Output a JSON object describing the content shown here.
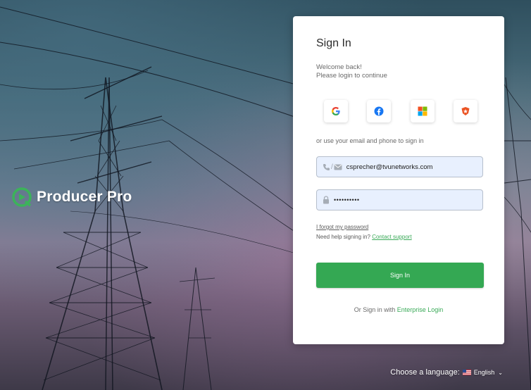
{
  "brand": {
    "name": "Producer Pro"
  },
  "card": {
    "title": "Sign In",
    "welcome_line1": "Welcome back!",
    "welcome_line2": "Please login to continue",
    "social_icons": [
      "google-icon",
      "facebook-icon",
      "microsoft-icon",
      "auth0-icon"
    ],
    "or_text": "or use your email and phone to sign in",
    "email_value": "csprecher@tvunetworks.com",
    "password_value": "••••••••••",
    "forgot_label": "I forgot my password",
    "help_prefix": "Need help signing in?",
    "help_link": "Contact support",
    "signin_label": "Sign In",
    "enterprise_prefix": "Or Sign in with",
    "enterprise_link": "Enterprise Login"
  },
  "language": {
    "label": "Choose a language:",
    "value": "English"
  },
  "colors": {
    "accent": "#34a853",
    "link": "#3aaa58"
  }
}
